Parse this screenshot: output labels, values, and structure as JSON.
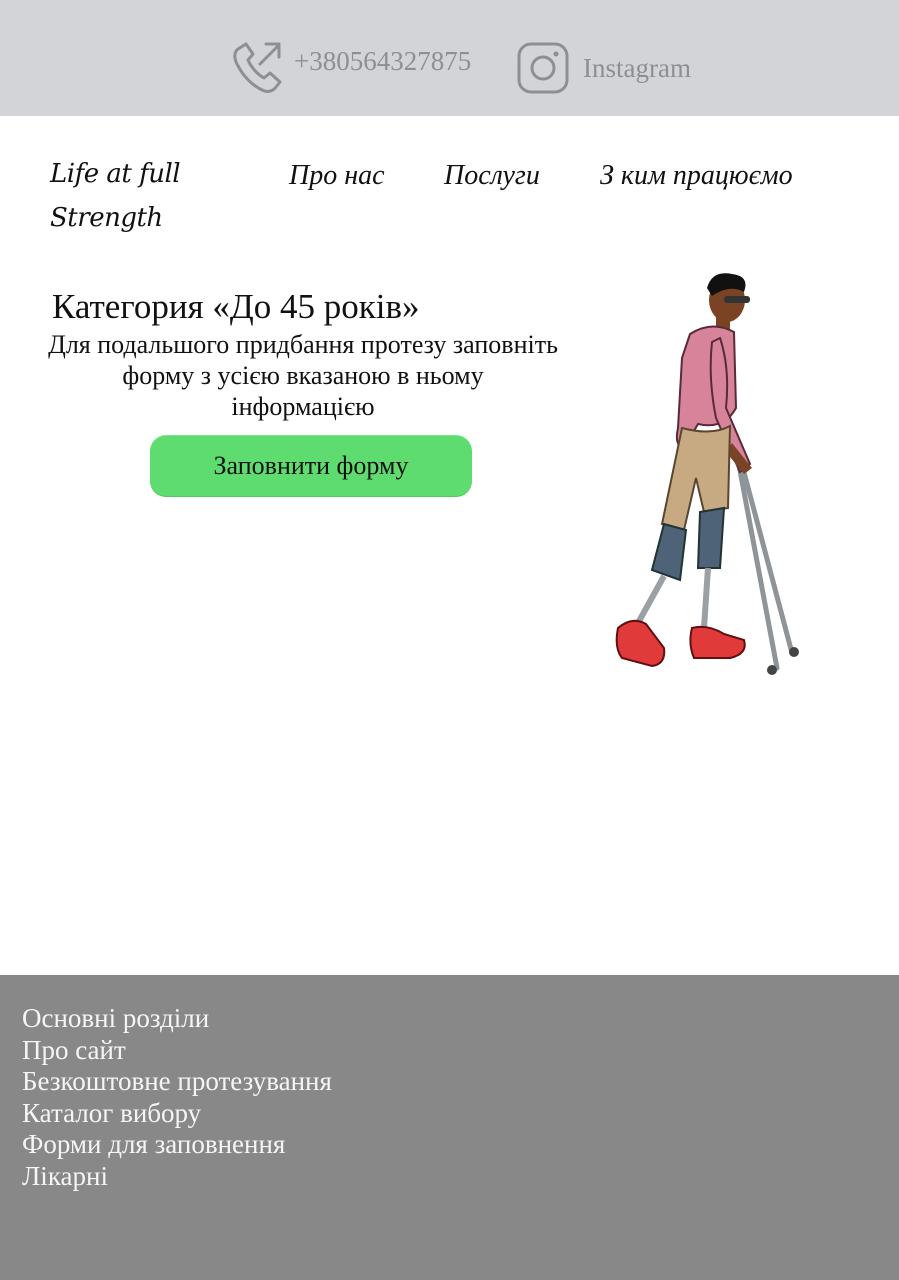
{
  "topbar": {
    "phone": {
      "icon": "phone-outgoing-icon",
      "number": "+380564327875"
    },
    "instagram": {
      "icon": "instagram-icon",
      "label": "Instagram"
    }
  },
  "header": {
    "logo_line1": "Life at full",
    "logo_line2": "Strength",
    "nav": [
      "Про нас",
      "Послуги",
      "З ким працюємо"
    ]
  },
  "hero": {
    "title": "Категория «До 45 років»",
    "description": "Для подальшого придбання протезу заповніть форму з усією вказаною в ньому інформацією",
    "cta_label": "Заповнити форму",
    "cta_color": "#5fdc70",
    "illustration": "man-with-leg-prostheses-and-crutches"
  },
  "footer": {
    "links": [
      "Основні розділи",
      "Про сайт",
      "Безкоштовне протезування",
      "Каталог вибору",
      "Форми для заповнення",
      "Лікарні"
    ]
  },
  "colors": {
    "topbar_bg": "#d3d4d8",
    "topbar_text": "#8d8f95",
    "footer_bg": "#888888"
  }
}
